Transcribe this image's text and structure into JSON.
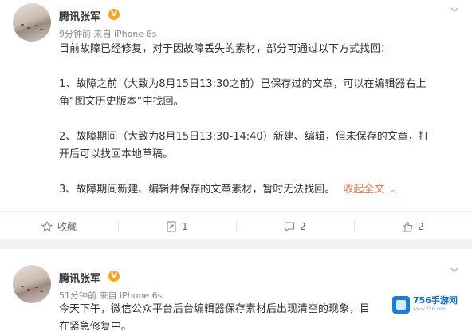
{
  "posts": [
    {
      "username": "腾讯张军",
      "verified_badge": "V",
      "meta": "9分钟前 来自 iPhone 6s",
      "lines": [
        "目前故障已经修复，对于因故障丢失的素材，部分可通过以下方式找回：",
        "",
        "1、故障之前（大致为8月15日13:30之前）已保存过的文章，可以在编辑器右上",
        "角“图文历史版本”中找回。",
        "",
        "2、故障期间（大致为8月15日13:30-14:40）新建、编辑，但未保存的文章，打",
        "开后可以找回本地草稿。",
        "",
        "3、故障期间新建、编辑并保存的文章素材，暂时无法找回。"
      ],
      "collapse_label": "收起全文",
      "actions": {
        "favorite_label": "收藏",
        "repost_count": "1",
        "comment_count": "2",
        "like_count": "2"
      }
    },
    {
      "username": "腾讯张军",
      "verified_badge": "V",
      "meta": "51分钟前 来自 iPhone 6s",
      "line1": "今天下午，微信公众平台后台编辑器保存素材后出现清空的现象，目",
      "line2": "在紧急修复中。"
    }
  ],
  "watermark": {
    "title": "756手游网",
    "url": "www.756.com"
  },
  "colors": {
    "link": "#eb7350",
    "badge": "#f6a524",
    "watermark": "#1b7fd6"
  },
  "icons": [
    "chevron-down-icon",
    "star-icon",
    "repost-icon",
    "comment-icon",
    "like-icon",
    "verified-icon"
  ]
}
